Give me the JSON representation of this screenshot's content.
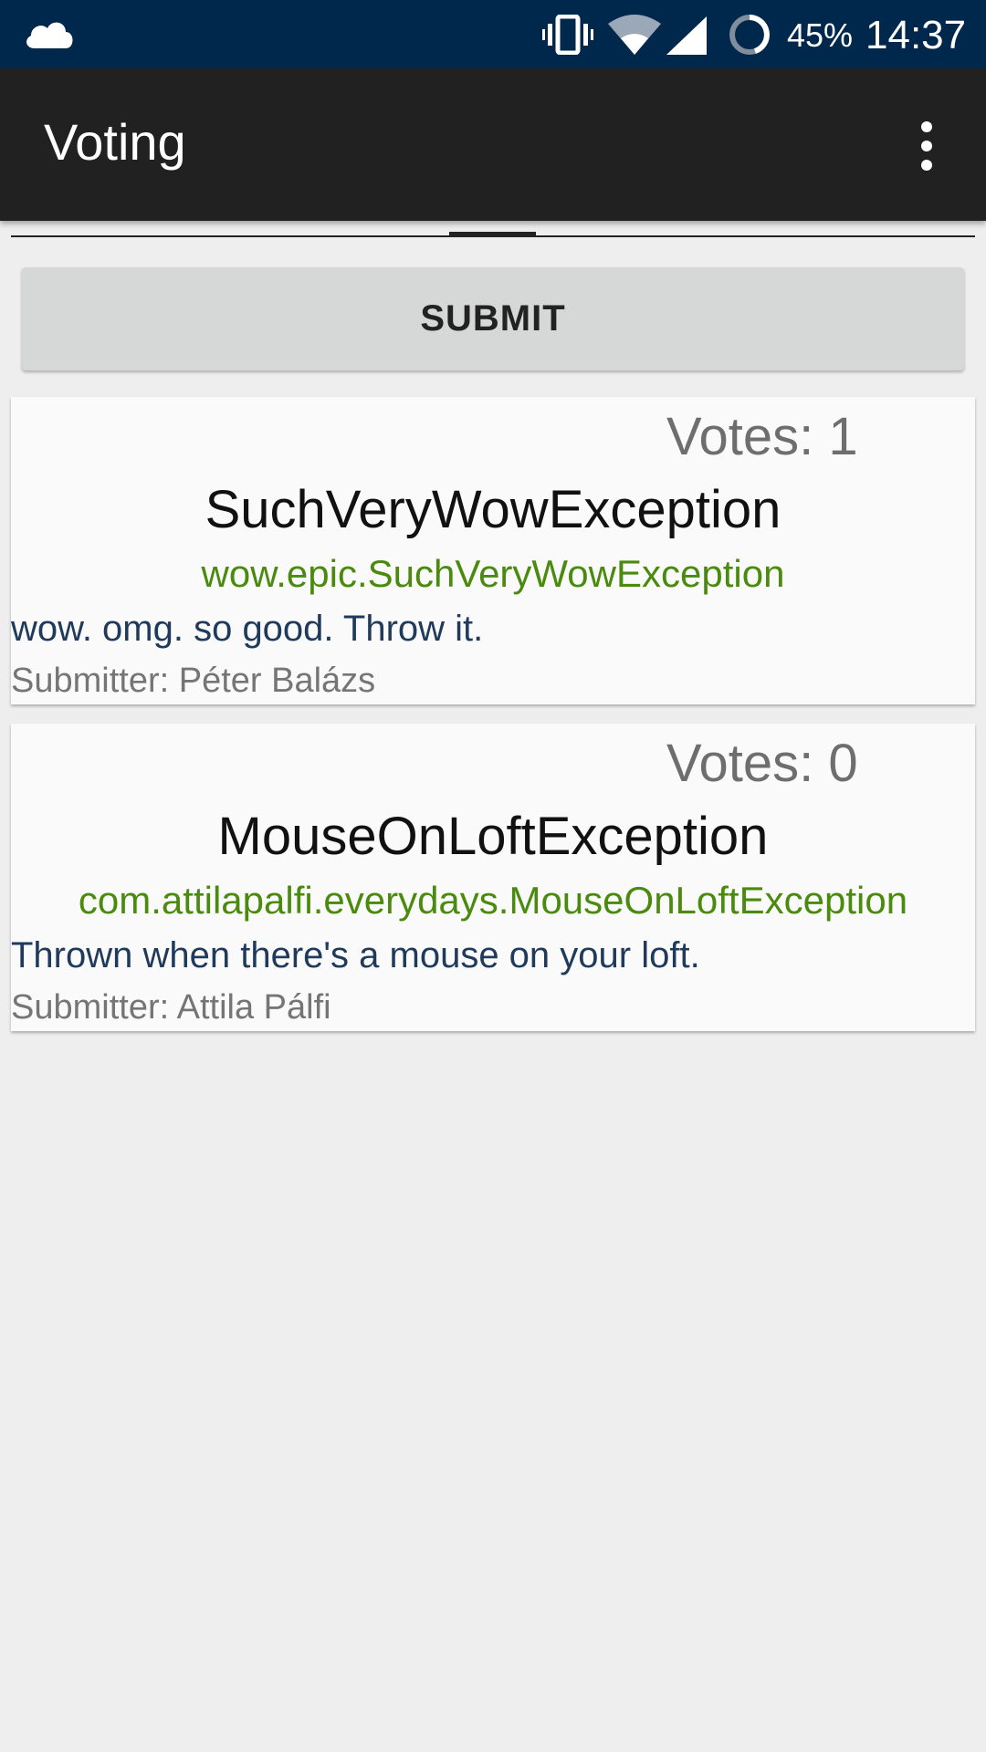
{
  "status_bar": {
    "battery_percent": "45%",
    "time": "14:37",
    "icons": [
      "cloud-icon",
      "vibrate-icon",
      "wifi-icon",
      "cell-signal-icon",
      "battery-icon"
    ]
  },
  "app_bar": {
    "title": "Voting",
    "menu_icon": "overflow-menu-icon"
  },
  "submit_label": "SUBMIT",
  "exceptions": [
    {
      "votes": "Votes: 1",
      "name": "SuchVeryWowException",
      "class_name": "wow.epic.SuchVeryWowException",
      "description": "wow. omg. so good. Throw it.",
      "submitter": "Submitter: Péter Balázs"
    },
    {
      "votes": "Votes: 0",
      "name": "MouseOnLoftException",
      "class_name": "com.attilapalfi.everydays.MouseOnLoftException",
      "description": "Thrown when there's a mouse on your loft.",
      "submitter": "Submitter: Attila Pálfi"
    }
  ],
  "colors": {
    "status_bar": "#00284d",
    "app_bar": "#212121",
    "background": "#eeeeee",
    "class_name": "#4a8a0d",
    "description": "#1f3a5a"
  }
}
